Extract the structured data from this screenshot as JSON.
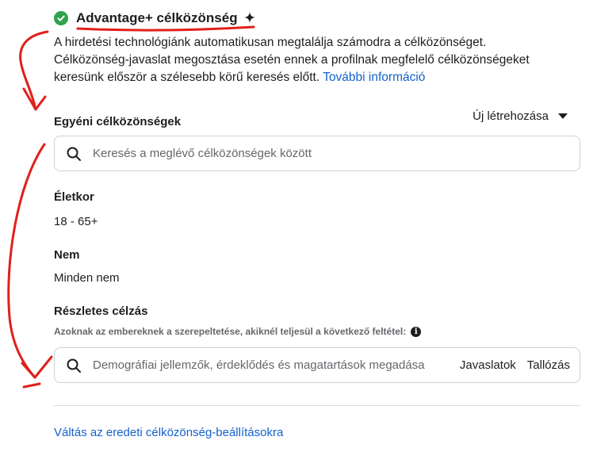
{
  "header": {
    "title": "Advantage+ célközönség",
    "check_icon": "check-circle-icon",
    "sparkle_icon": "sparkle-icon",
    "check_color": "#31a24c"
  },
  "description": {
    "line1": "A hirdetési technológiánk automatikusan megtalálja számodra a célközönséget.",
    "line2": "Célközönség-javaslat megosztása esetén ennek a profilnak megfelelő célközönségeket",
    "line3": "keresünk először a szélesebb körű keresés előtt.",
    "link": "További információ"
  },
  "custom_audiences": {
    "label": "Egyéni célközönségek",
    "create_new": "Új létrehozása",
    "search_placeholder": "Keresés a meglévő célközönségek között"
  },
  "age": {
    "label": "Életkor",
    "value": "18 - 65+"
  },
  "gender": {
    "label": "Nem",
    "value": "Minden nem"
  },
  "detailed_targeting": {
    "label": "Részletes célzás",
    "note": "Azoknak az embereknek a szerepeltetése, akiknél teljesül a következő feltétel:",
    "search_placeholder": "Demográfiai jellemzők, érdeklődés és magatartások megadása",
    "suggestions": "Javaslatok",
    "browse": "Tallózás"
  },
  "footer": {
    "switch_link": "Váltás az eredeti célközönség-beállításokra"
  },
  "colors": {
    "link": "#1461cc",
    "annotation": "#e0201b"
  }
}
